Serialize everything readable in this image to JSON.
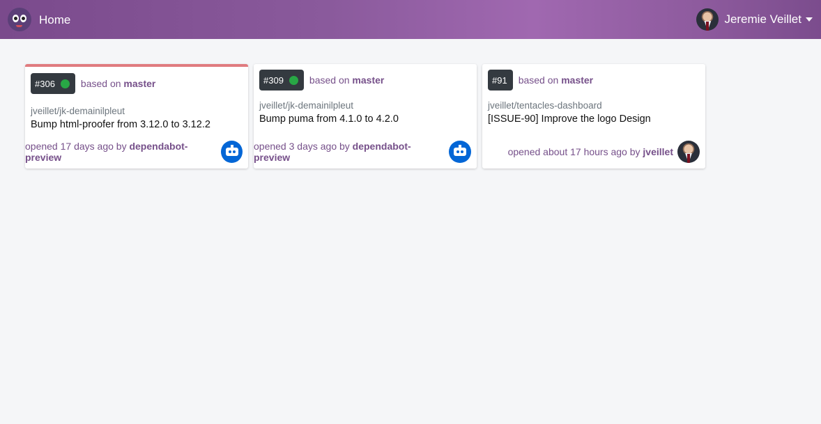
{
  "nav": {
    "home_label": "Home",
    "user_name": "Jeremie Veillet"
  },
  "cards": [
    {
      "number": "#306",
      "status": "success",
      "based_prefix": "based on",
      "branch": "master",
      "repo": "jveillet/jk-demainilpleut",
      "title": "Bump html-proofer from 3.12.0 to 3.12.2",
      "opened_text": "opened 17 days ago by",
      "author": "dependabot-preview",
      "avatar": "dependabot-icon"
    },
    {
      "number": "#309",
      "status": "success",
      "based_prefix": "based on",
      "branch": "master",
      "repo": "jveillet/jk-demainilpleut",
      "title": "Bump puma from 4.1.0 to 4.2.0",
      "opened_text": "opened 3 days ago by",
      "author": "dependabot-preview",
      "avatar": "dependabot-icon"
    },
    {
      "number": "#91",
      "based_prefix": "based on",
      "branch": "master",
      "repo": "jveillet/tentacles-dashboard",
      "title": "[ISSUE-90] Improve the logo Design",
      "opened_text": "opened about 17 hours ago by",
      "author": "jveillet",
      "avatar": "user-avatar"
    }
  ],
  "colors": {
    "accent": "#76508a",
    "badge_bg": "#343a40",
    "status_green": "#28a745",
    "failed_border": "#e07b7f",
    "dependabot_blue": "#0366d6"
  }
}
